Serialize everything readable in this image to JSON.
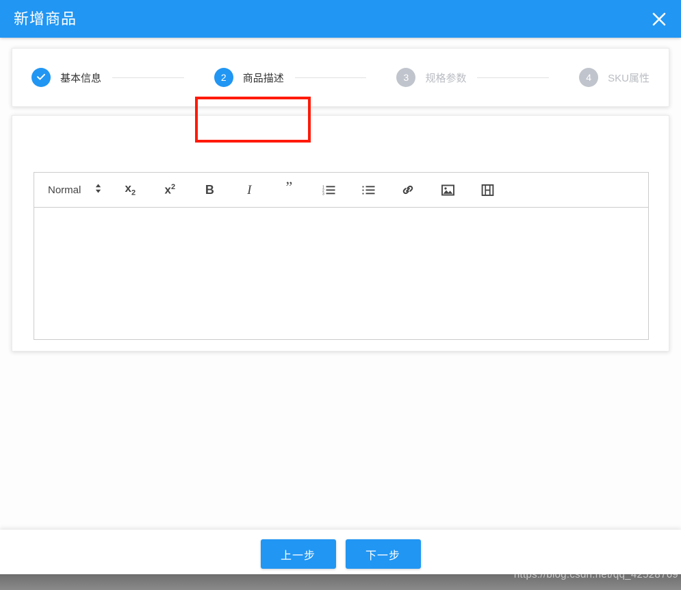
{
  "header": {
    "title": "新增商品",
    "close_icon": "close-icon",
    "accent_color": "#2196f3"
  },
  "steps": [
    {
      "index": "1",
      "label": "基本信息",
      "state": "done",
      "icon": "check-icon"
    },
    {
      "index": "2",
      "label": "商品描述",
      "state": "active"
    },
    {
      "index": "3",
      "label": "规格参数",
      "state": "pending"
    },
    {
      "index": "4",
      "label": "SKU属性",
      "state": "pending"
    }
  ],
  "annotation": {
    "color": "#ff1a09",
    "target": "商品描述"
  },
  "editor": {
    "format_picker": {
      "value": "Normal",
      "icon": "chevron-updown-icon"
    },
    "toolbar": [
      {
        "name": "subscript-button",
        "label": "x",
        "sup": "2"
      },
      {
        "name": "superscript-button",
        "label": "x",
        "sup": "2"
      },
      {
        "name": "bold-button",
        "label": "B"
      },
      {
        "name": "italic-button",
        "label": "I"
      },
      {
        "name": "blockquote-button",
        "label": "”"
      },
      {
        "name": "ordered-list-button",
        "label": ""
      },
      {
        "name": "bullet-list-button",
        "label": ""
      },
      {
        "name": "link-button",
        "label": ""
      },
      {
        "name": "image-button",
        "label": ""
      },
      {
        "name": "video-button",
        "label": ""
      }
    ],
    "content": "",
    "placeholder": ""
  },
  "footer": {
    "prev_label": "上一步",
    "next_label": "下一步"
  },
  "watermark": {
    "text": "https://blog.csdn.net/qq_42528769"
  }
}
